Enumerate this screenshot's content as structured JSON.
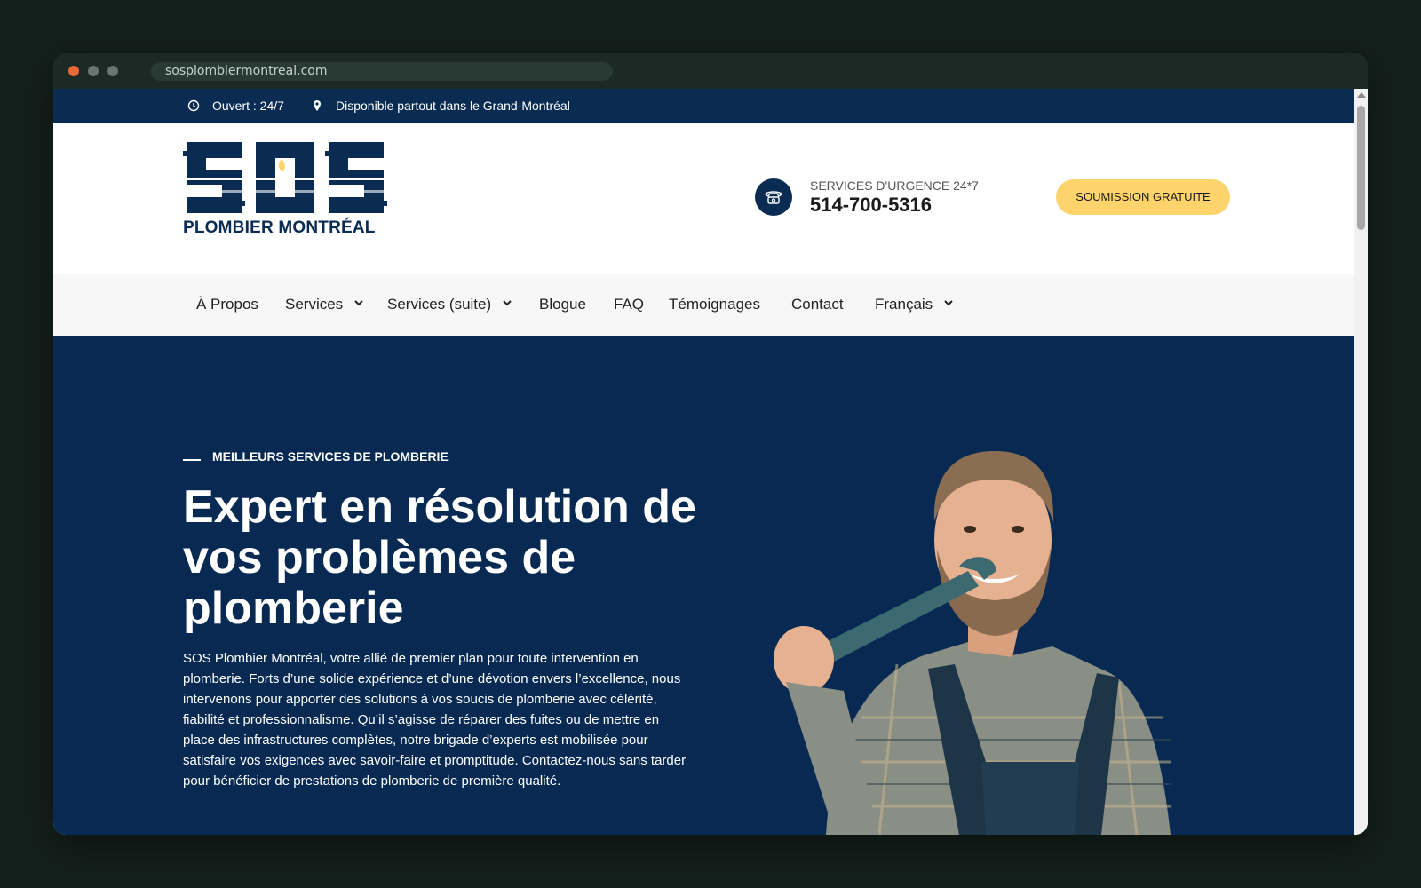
{
  "browser": {
    "url": "sosplombiermontreal.com"
  },
  "infobar": {
    "hours": "Ouvert : 24/7",
    "area": "Disponible partout dans le Grand-Montréal",
    "icons": [
      "clock-icon",
      "location-pin-icon"
    ]
  },
  "header": {
    "logo_brand": "SOS",
    "logo_subtitle": "PLOMBIER MONTRÉAL",
    "phone_label": "SERVICES D'URGENCE 24*7",
    "phone_number": "514-700-5316",
    "cta_label": "SOUMISSION GRATUITE"
  },
  "nav": {
    "items": [
      {
        "label": "À Propos"
      },
      {
        "label": "Services"
      },
      {
        "label": "Services (suite)"
      },
      {
        "label": "Blogue"
      },
      {
        "label": "FAQ"
      },
      {
        "label": "Témoignages"
      },
      {
        "label": "Contact"
      },
      {
        "label": "Français"
      }
    ]
  },
  "hero": {
    "eyebrow": "MEILLEURS SERVICES DE PLOMBERIE",
    "title": "Expert en résolution de vos problèmes de plomberie",
    "text": "SOS Plombier Montréal, votre allié de premier plan pour toute intervention en plomberie. Forts d’une solide expérience et d’une dévotion envers l’excellence, nous intervenons pour apporter des solutions à vos soucis de plomberie avec célérité, fiabilité et professionnalisme. Qu’il s’agisse de réparer des fuites ou de mettre en place des infrastructures complètes, notre brigade d’experts est mobilisée pour satisfaire vos exigences avec savoir-faire et promptitude. Contactez-nous sans tarder pour bénéficier de prestations de plomberie de première qualité."
  },
  "colors": {
    "navy": "#0a2b52",
    "accent_yellow": "#fdd46b",
    "nav_bg": "#f7f7f7"
  }
}
